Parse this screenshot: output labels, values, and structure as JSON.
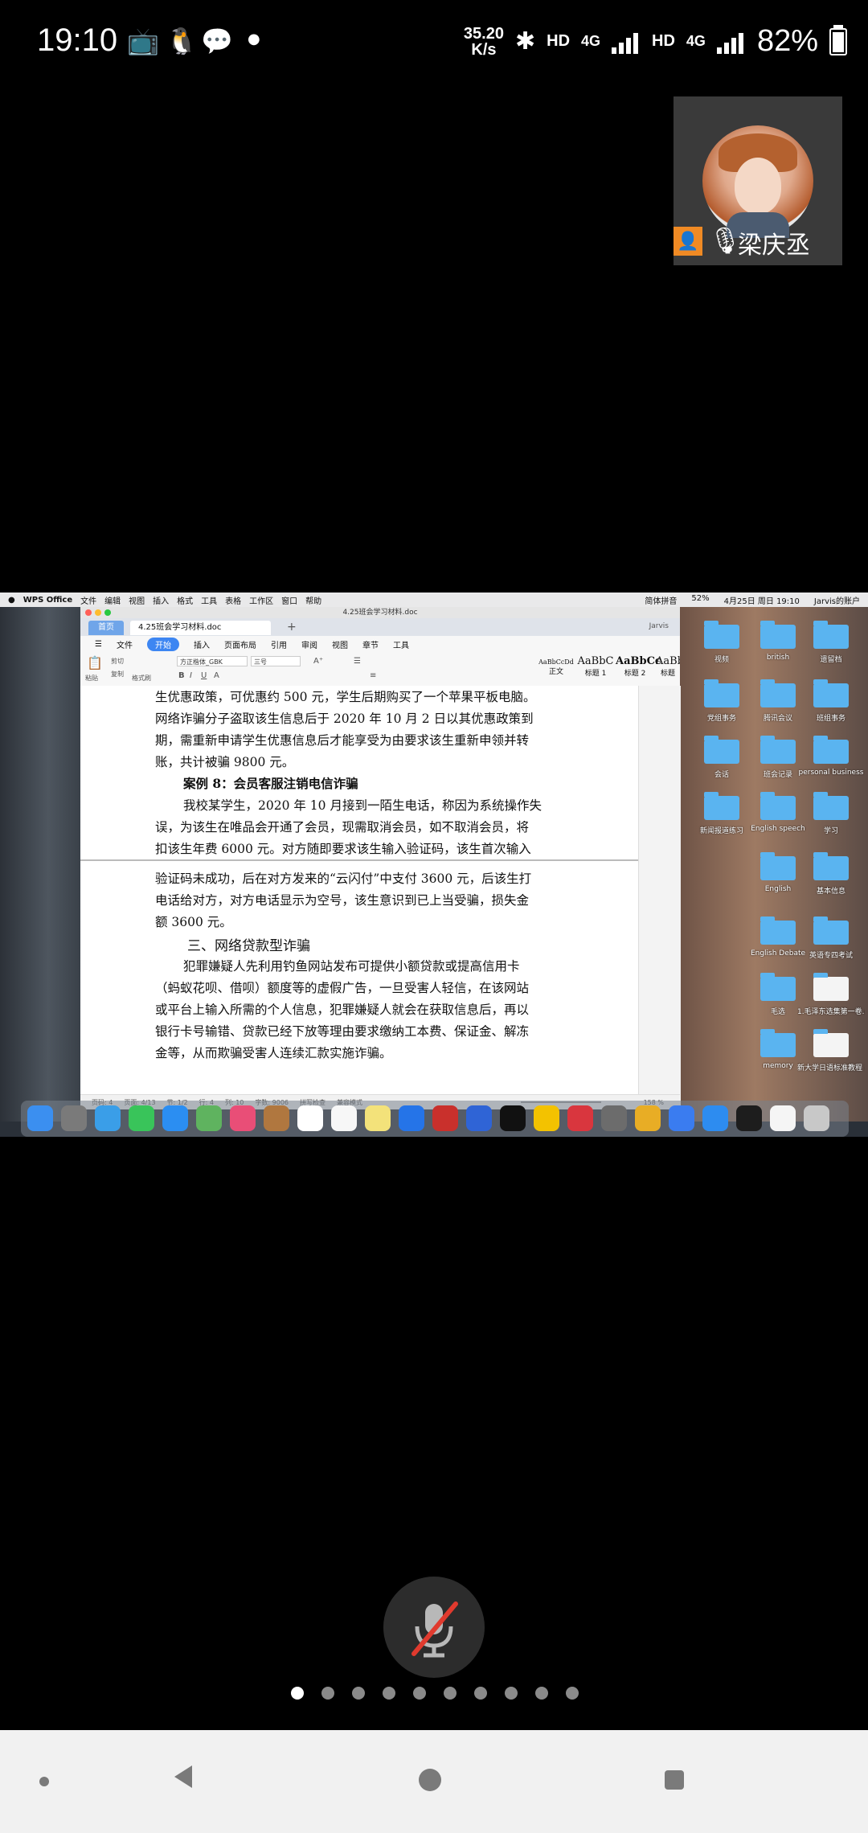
{
  "status_bar": {
    "time": "19:10",
    "speed_value": "35.20",
    "speed_unit": "K/s",
    "hd1": "HD",
    "net1": "4G",
    "hd2": "HD",
    "net2": "4G",
    "battery": "82%"
  },
  "participant": {
    "name": "梁庆丞"
  },
  "mac_menubar": {
    "app": "WPS Office",
    "items": [
      "文件",
      "编辑",
      "视图",
      "插入",
      "格式",
      "工具",
      "表格",
      "工作区",
      "窗口",
      "帮助"
    ],
    "right": [
      "简体拼音",
      "52%",
      "4月25日 周日 19:10",
      "Jarvis的账户"
    ]
  },
  "wps": {
    "window_title": "4.25班会学习材料.doc",
    "tab_home": "首页",
    "tab_doc": "4.25班会学习材料.doc",
    "tab_plus": "+",
    "user": "Jarvis",
    "ribbon_menu": [
      "文件",
      "开始",
      "插入",
      "页面布局",
      "引用",
      "审阅",
      "视图",
      "章节",
      "工具"
    ],
    "active_menu": "开始",
    "toolbar": {
      "paste": "粘贴",
      "cut": "剪切",
      "copy": "复制",
      "format_painter": "格式刷",
      "font": "方正楷体_GBK",
      "size": "三号",
      "styles": [
        {
          "sample": "AaBbCcDd",
          "name": "正文"
        },
        {
          "sample": "AaBbC",
          "name": "标题 1"
        },
        {
          "sample": "AaBbCc",
          "name": "标题 2"
        },
        {
          "sample": "AaBb",
          "name": "标题"
        }
      ]
    },
    "document_lines": [
      "生优惠政策，可优惠约 500 元，学生后期购买了一个苹果平板电脑。",
      "网络诈骗分子盗取该生信息后于 2020 年 10 月 2 日以其优惠政策到",
      "期，需重新申请学生优惠信息后才能享受为由要求该生重新申领并转",
      "账，共计被骗 9800 元。",
      "案例 8：会员客服注销电信诈骗",
      "我校某学生，2020 年 10 月接到一陌生电话，称因为系统操作失",
      "误，为该生在唯品会开通了会员，现需取消会员，如不取消会员，将",
      "扣该生年费 6000 元。对方随即要求该生输入验证码，该生首次输入",
      "验证码未成功，后在对方发来的“云闪付”中支付 3600 元，后该生打",
      "电话给对方，对方电话显示为空号，该生意识到已上当受骗，损失金",
      "额 3600 元。",
      "三、网络贷款型诈骗",
      "犯罪嫌疑人先利用钓鱼网站发布可提供小额贷款或提高信用卡",
      "（蚂蚁花呗、借呗）额度等的虚假广告，一旦受害人轻信，在该网站",
      "或平台上输入所需的个人信息，犯罪嫌疑人就会在获取信息后，再以",
      "银行卡号输错、贷款已经下放等理由要求缴纳工本费、保证金、解冻",
      "金等，从而欺骗受害人连续汇款实施诈骗。"
    ],
    "status": [
      "页码: 4",
      "页面: 4/13",
      "节: 1/2",
      "行: 4",
      "列: 10",
      "字数: 9006",
      "拼写检查",
      "兼容模式"
    ],
    "zoom": "158 %"
  },
  "desktop_icons": [
    "视频",
    "british",
    "遗留档",
    "党组事务",
    "腾讯会议",
    "班组事务",
    "会话",
    "班会记录",
    "personal business",
    "新闻报道练习",
    "English speech",
    "学习",
    "English",
    "基本信息",
    "English Debate",
    "英语专四考试",
    "毛选",
    "1.毛泽东选集第一卷.docx",
    "memory",
    "新大学日语标准教程 基础篇 1.pdf"
  ],
  "page_dots": 10,
  "active_dot": 0
}
